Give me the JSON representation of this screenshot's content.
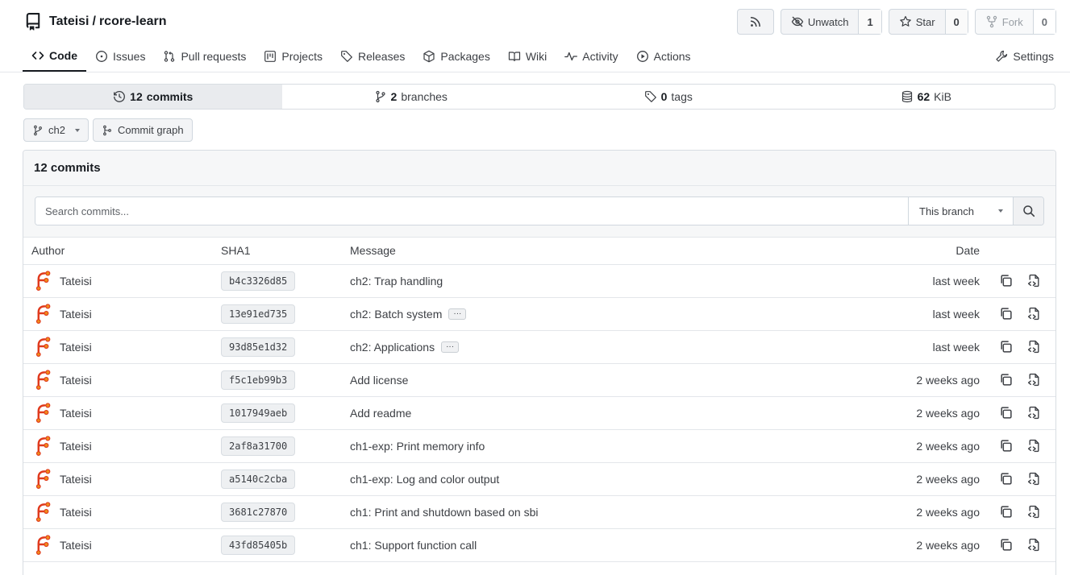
{
  "repo": {
    "owner": "Tateisi",
    "separator": "/",
    "name": "rcore-learn"
  },
  "header_actions": {
    "unwatch_label": "Unwatch",
    "unwatch_count": "1",
    "star_label": "Star",
    "star_count": "0",
    "fork_label": "Fork",
    "fork_count": "0"
  },
  "tabs": [
    {
      "label": "Code",
      "icon": "code-icon"
    },
    {
      "label": "Issues",
      "icon": "issue-icon"
    },
    {
      "label": "Pull requests",
      "icon": "pull-request-icon"
    },
    {
      "label": "Projects",
      "icon": "project-icon"
    },
    {
      "label": "Releases",
      "icon": "tag-icon"
    },
    {
      "label": "Packages",
      "icon": "package-icon"
    },
    {
      "label": "Wiki",
      "icon": "book-icon"
    },
    {
      "label": "Activity",
      "icon": "pulse-icon"
    },
    {
      "label": "Actions",
      "icon": "play-icon"
    },
    {
      "label": "Settings",
      "icon": "tool-icon"
    }
  ],
  "stats": {
    "commits_count": "12",
    "commits_label": "commits",
    "branches_count": "2",
    "branches_label": "branches",
    "tags_count": "0",
    "tags_label": "tags",
    "size_value": "62",
    "size_unit": "KiB"
  },
  "branch": {
    "current": "ch2",
    "graph_label": "Commit graph"
  },
  "panel": {
    "title": "12 commits"
  },
  "search": {
    "placeholder": "Search commits...",
    "scope": "This branch"
  },
  "table": {
    "headers": {
      "author": "Author",
      "sha": "SHA1",
      "message": "Message",
      "date": "Date"
    },
    "rows": [
      {
        "author": "Tateisi",
        "sha": "b4c3326d85",
        "message": "ch2: Trap handling",
        "has_more": false,
        "date": "last week"
      },
      {
        "author": "Tateisi",
        "sha": "13e91ed735",
        "message": "ch2: Batch system",
        "has_more": true,
        "date": "last week"
      },
      {
        "author": "Tateisi",
        "sha": "93d85e1d32",
        "message": "ch2: Applications",
        "has_more": true,
        "date": "last week"
      },
      {
        "author": "Tateisi",
        "sha": "f5c1eb99b3",
        "message": "Add license",
        "has_more": false,
        "date": "2 weeks ago"
      },
      {
        "author": "Tateisi",
        "sha": "1017949aeb",
        "message": "Add readme",
        "has_more": false,
        "date": "2 weeks ago"
      },
      {
        "author": "Tateisi",
        "sha": "2af8a31700",
        "message": "ch1-exp: Print memory info",
        "has_more": false,
        "date": "2 weeks ago"
      },
      {
        "author": "Tateisi",
        "sha": "a5140c2cba",
        "message": "ch1-exp: Log and color output",
        "has_more": false,
        "date": "2 weeks ago"
      },
      {
        "author": "Tateisi",
        "sha": "3681c27870",
        "message": "ch1: Print and shutdown based on sbi",
        "has_more": false,
        "date": "2 weeks ago"
      },
      {
        "author": "Tateisi",
        "sha": "43fd85405b",
        "message": "ch1: Support function call",
        "has_more": false,
        "date": "2 weeks ago"
      }
    ]
  },
  "colors": {
    "avatar_red": "#e03a1e",
    "avatar_orange": "#f08c1a",
    "border": "#d0d7de"
  }
}
